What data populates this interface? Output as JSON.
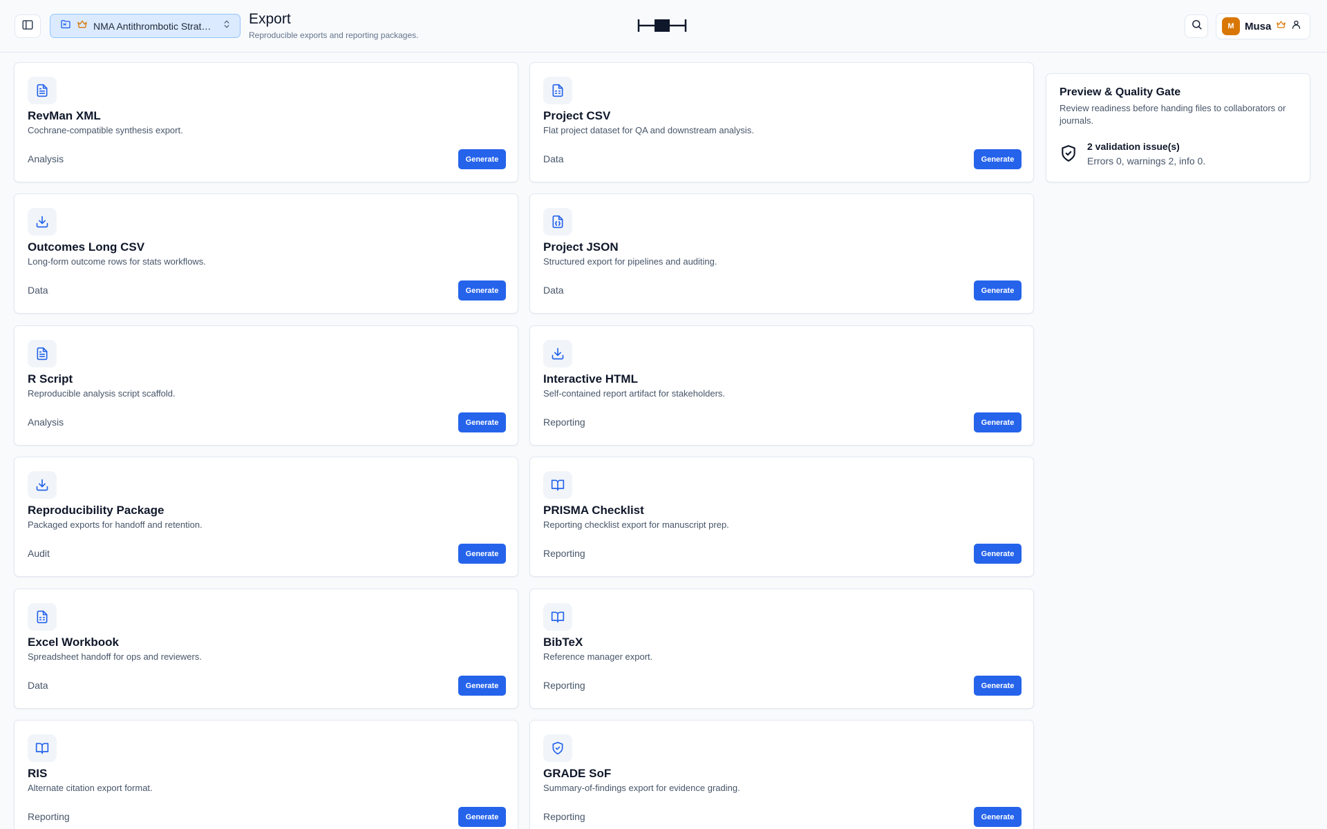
{
  "header": {
    "project_name": "NMA Antithrombotic Strateg...",
    "page_title": "Export",
    "page_subtitle": "Reproducible exports and reporting packages.",
    "user_initial": "M",
    "user_name": "Musa"
  },
  "colors": {
    "accent": "#2563eb",
    "premium_crown": "#d97706",
    "avatar": "#d97706"
  },
  "export_cards": [
    {
      "title": "RevMan XML",
      "description": "Cochrane-compatible synthesis export.",
      "category": "Analysis",
      "button": "Generate",
      "icon": "file-text-icon"
    },
    {
      "title": "Project CSV",
      "description": "Flat project dataset for QA and downstream analysis.",
      "category": "Data",
      "button": "Generate",
      "icon": "file-spreadsheet-icon"
    },
    {
      "title": "Outcomes Long CSV",
      "description": "Long-form outcome rows for stats workflows.",
      "category": "Data",
      "button": "Generate",
      "icon": "download-icon"
    },
    {
      "title": "Project JSON",
      "description": "Structured export for pipelines and auditing.",
      "category": "Data",
      "button": "Generate",
      "icon": "file-json-icon"
    },
    {
      "title": "R Script",
      "description": "Reproducible analysis script scaffold.",
      "category": "Analysis",
      "button": "Generate",
      "icon": "file-text-icon"
    },
    {
      "title": "Interactive HTML",
      "description": "Self-contained report artifact for stakeholders.",
      "category": "Reporting",
      "button": "Generate",
      "icon": "download-icon"
    },
    {
      "title": "Reproducibility Package",
      "description": "Packaged exports for handoff and retention.",
      "category": "Audit",
      "button": "Generate",
      "icon": "download-icon"
    },
    {
      "title": "PRISMA Checklist",
      "description": "Reporting checklist export for manuscript prep.",
      "category": "Reporting",
      "button": "Generate",
      "icon": "book-open-icon"
    },
    {
      "title": "Excel Workbook",
      "description": "Spreadsheet handoff for ops and reviewers.",
      "category": "Data",
      "button": "Generate",
      "icon": "file-spreadsheet-icon"
    },
    {
      "title": "BibTeX",
      "description": "Reference manager export.",
      "category": "Reporting",
      "button": "Generate",
      "icon": "book-open-icon"
    },
    {
      "title": "RIS",
      "description": "Alternate citation export format.",
      "category": "Reporting",
      "button": "Generate",
      "icon": "book-open-icon"
    },
    {
      "title": "GRADE SoF",
      "description": "Summary-of-findings export for evidence grading.",
      "category": "Reporting",
      "button": "Generate",
      "icon": "shield-check-icon"
    }
  ],
  "preview_panel": {
    "title": "Preview & Quality Gate",
    "description": "Review readiness before handing files to collaborators or journals.",
    "issues_title": "2 validation issue(s)",
    "issues_detail": "Errors 0, warnings 2, info 0."
  }
}
